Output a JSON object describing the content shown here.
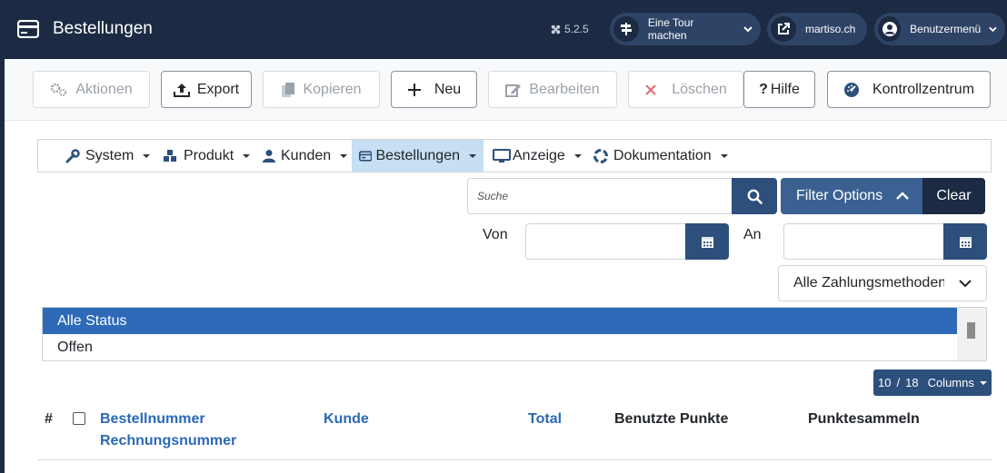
{
  "header": {
    "title": "Bestellungen",
    "version": "5.2.5",
    "tour_label": "Eine Tour machen",
    "site_label": "martiso.ch",
    "user_menu_label": "Benutzermenü"
  },
  "toolbar": {
    "actions_label": "Aktionen",
    "export_label": "Export",
    "copy_label": "Kopieren",
    "new_label": "Neu",
    "edit_label": "Bearbeiten",
    "delete_label": "Löschen",
    "help_label": "Hilfe",
    "control_center_label": "Kontrollzentrum"
  },
  "submenu": {
    "items": [
      {
        "label": "System",
        "icon": "wrench-icon"
      },
      {
        "label": "Produkt",
        "icon": "cubes-icon"
      },
      {
        "label": "Kunden",
        "icon": "user-icon"
      },
      {
        "label": "Bestellungen",
        "icon": "orders-icon"
      },
      {
        "label": "Anzeige",
        "icon": "monitor-icon"
      },
      {
        "label": "Dokumentation",
        "icon": "lifebuoy-icon"
      }
    ],
    "active": "Bestellungen"
  },
  "filters": {
    "search_placeholder": "Suche",
    "filter_options_label": "Filter Options",
    "clear_label": "Clear",
    "from_label": "Von",
    "to_label": "An",
    "payment_method_selected": "Alle Zahlungsmethoden",
    "status_options": [
      "Alle Status",
      "Offen"
    ],
    "status_selected": "Alle Status"
  },
  "columns_button": {
    "shown": "10",
    "separator": "/",
    "total": "18",
    "label": "Columns"
  },
  "table": {
    "headers": {
      "number": "#",
      "order_number": "Bestellnummer",
      "invoice_number": "Rechnungsnummer",
      "customer": "Kunde",
      "total": "Total",
      "used_points": "Benutzte Punkte",
      "collect_points": "Punktesammeln"
    }
  },
  "colors": {
    "header_bg": "#1c2a43",
    "primary_button": "#2d4f7b",
    "filter_button": "#3a6191",
    "selected_row": "#2e6ab8",
    "link": "#2a69b8",
    "submenu_active": "#c6dff2"
  }
}
